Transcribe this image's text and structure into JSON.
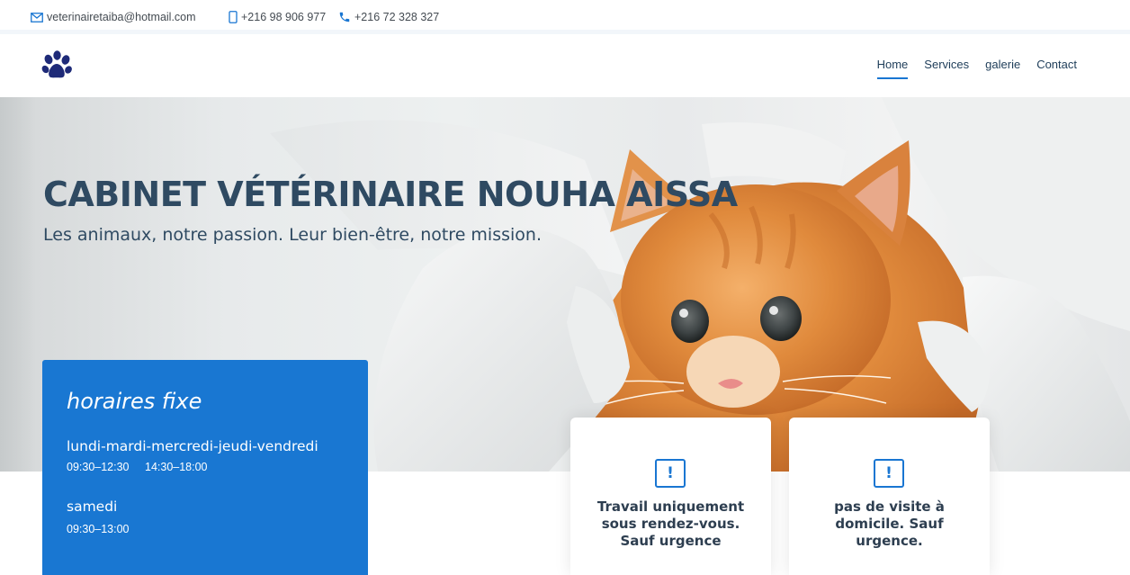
{
  "topbar": {
    "email": "veterinairetaiba@hotmail.com",
    "mobile": "+216 98 906 977",
    "phone": "+216 72 328 327",
    "icons": [
      "envelope-icon",
      "mobile-icon",
      "phone-icon"
    ]
  },
  "header": {
    "logo_icon": "paw-icon",
    "nav": [
      {
        "label": "Home",
        "active": true
      },
      {
        "label": "Services",
        "active": false
      },
      {
        "label": "galerie",
        "active": false
      },
      {
        "label": "Contact",
        "active": false
      }
    ]
  },
  "hero": {
    "title": "CABINET VÉTÉRINAIRE NOUHA AISSA",
    "subtitle": "Les animaux, notre passion. Leur bien-être, notre mission."
  },
  "hours": {
    "title": "horaires fixe",
    "schedule": [
      {
        "days": "lundi-mardi-mercredi-jeudi-vendredi",
        "times": [
          "09:30–12:30",
          "14:30–18:00"
        ]
      },
      {
        "days": "samedi",
        "times": [
          "09:30–13:00"
        ]
      }
    ]
  },
  "notices": [
    {
      "icon": "exclamation-icon",
      "text": "Travail uniquement sous rendez-vous. Sauf urgence"
    },
    {
      "icon": "exclamation-icon",
      "text": "pas de visite à domicile. Sauf urgence."
    }
  ],
  "colors": {
    "accent": "#1976d2",
    "title_text": "#2f4a62",
    "hours_box": "#1977d2"
  }
}
